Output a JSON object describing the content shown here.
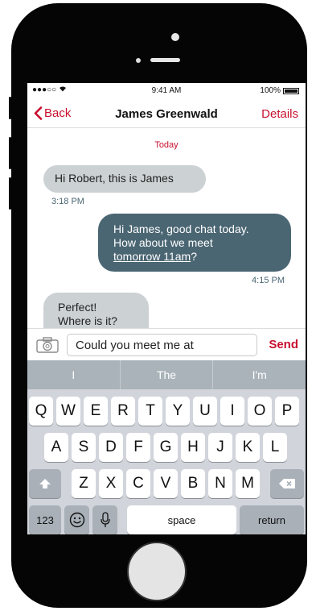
{
  "status": {
    "signal": "●●●○○",
    "wifi": "wifi-icon",
    "time": "9:41 AM",
    "battery": "100%"
  },
  "nav": {
    "back_label": "Back",
    "title": "James Greenwald",
    "details_label": "Details"
  },
  "conversation": {
    "date_label": "Today",
    "messages": [
      {
        "from": "James",
        "text": "Hi Robert, this is James",
        "time": "3:18 PM"
      },
      {
        "from": "Robert",
        "line1": "Hi James, good chat today.",
        "line2": "How about we meet",
        "link": "tomorrow 11am",
        "after_link": "?",
        "time": "4:15 PM"
      },
      {
        "from": "James",
        "line1": "Perfect!",
        "line2": "Where is it?"
      }
    ]
  },
  "composer": {
    "value": "Could you meet me at",
    "send_label": "Send",
    "camera_icon": "camera-icon"
  },
  "predictions": [
    "I",
    "The",
    "I'm"
  ],
  "keyboard": {
    "row1": [
      "Q",
      "W",
      "E",
      "R",
      "T",
      "Y",
      "U",
      "I",
      "O",
      "P"
    ],
    "row2": [
      "A",
      "S",
      "D",
      "F",
      "G",
      "H",
      "J",
      "K",
      "L"
    ],
    "row3": [
      "Z",
      "X",
      "C",
      "V",
      "B",
      "N",
      "M"
    ],
    "numbers_label": "123",
    "space_label": "space",
    "return_label": "return"
  },
  "colors": {
    "accent": "#c8102e",
    "outgoing_bubble": "#4b6673",
    "incoming_bubble": "#ccd1d4",
    "keyboard_bg": "#d1d5db"
  }
}
